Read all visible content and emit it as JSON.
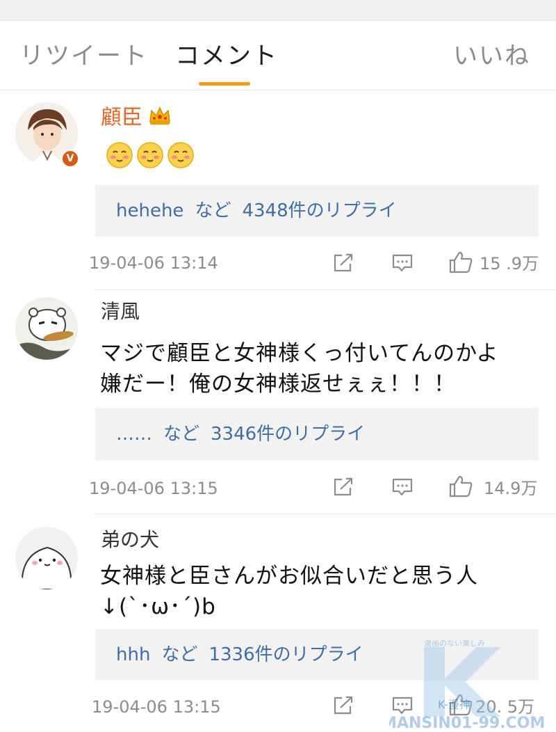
{
  "tabs": {
    "retweet": "リツイート",
    "comment": "コメント",
    "likes": "いいね",
    "active": "comment"
  },
  "accent_color": "#f39c1c",
  "link_color": "#3d6ea8",
  "comments": [
    {
      "user": "顧臣",
      "verified": true,
      "has_crown": true,
      "text_lines": [],
      "emoji": [
        "blush-emoji",
        "blush-emoji",
        "blush-emoji"
      ],
      "reply_preview": {
        "who": "hehehe",
        "nado": "など",
        "count": "4348件のリプライ"
      },
      "timestamp": "19-04-06 13:14",
      "likes": "15 .9万"
    },
    {
      "user": "清風",
      "verified": false,
      "has_crown": false,
      "text_lines": [
        "マジで顧臣と女神様くっ付いてんのかよ",
        "嫌だー！俺の女神様返せぇぇ！！！"
      ],
      "reply_preview": {
        "who": "……",
        "nado": "など",
        "count": "3346件のリプライ"
      },
      "timestamp": "19-04-06 13:15",
      "likes": "14.9万"
    },
    {
      "user": "弟の犬",
      "verified": false,
      "has_crown": false,
      "text_lines": [
        "女神様と臣さんがお似合いだと思う人",
        "↓(`･ω･´)b"
      ],
      "reply_preview": {
        "who": "hhh",
        "nado": "など",
        "count": "1336件のリプライ"
      },
      "timestamp": "19-04-06 13:15",
      "likes": "20. 5万"
    }
  ],
  "icons": {
    "repost": "share-icon",
    "comment": "comment-icon",
    "like": "thumbs-up-icon"
  },
  "watermark": {
    "top": "漫画のない楽しみ",
    "mid": "K-漫神",
    "bottom": "KMANSIN01-99.COM"
  }
}
